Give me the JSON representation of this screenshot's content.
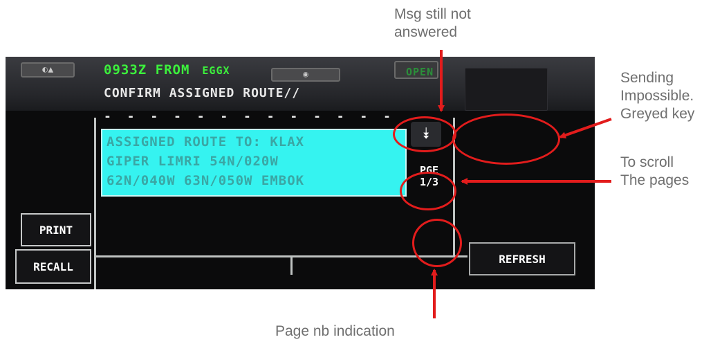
{
  "annotations": {
    "msg_not_answered": "Msg still not\nanswered",
    "sending_impossible": "Sending\nImpossible.\nGreyed key",
    "scroll": "To scroll\nThe pages",
    "page_indication": "Page nb indication"
  },
  "display": {
    "header_time_from": "0933Z FROM",
    "header_station": "EGGX",
    "message": "CONFIRM ASSIGNED ROUTE//",
    "separator": "- - - - - - - - - - - - -",
    "status": "OPEN",
    "response_lines": [
      "ASSIGNED ROUTE TO: KLAX",
      "GIPER LIMRI 54N/020W",
      "62N/040W 63N/050W EMBOK"
    ],
    "page_label": "PGE",
    "page_number": "1/3",
    "scroll_glyph": "⯯"
  },
  "buttons": {
    "print": "PRINT",
    "recall": "RECALL",
    "refresh": "REFRESH"
  },
  "bezel": {
    "left_button_mark": "◐▲",
    "center_button_mark": "◉"
  },
  "colors": {
    "annotation_red": "#e21c1c",
    "header_green": "#3cf03c",
    "response_cyan": "#35f3f0"
  }
}
